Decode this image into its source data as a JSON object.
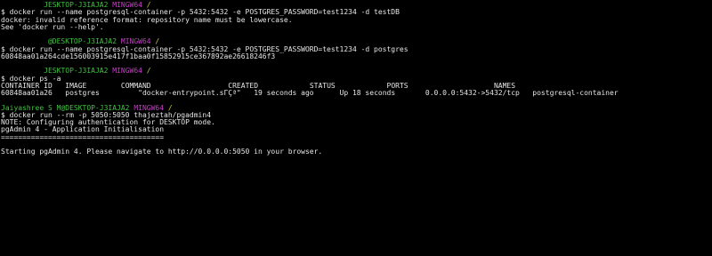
{
  "colors": {
    "background": "#000000",
    "text": "#e6e6e6",
    "user": "#3ec43e",
    "host": "#3ec43e",
    "shell": "#c23fc2",
    "path": "#c8c83a"
  },
  "lines": [
    {
      "type": "prompt",
      "user": "",
      "host": "JESKTOP-J3IAJA2",
      "shell": "MINGW64",
      "path": "/"
    },
    {
      "type": "text",
      "text": "$ docker run --name postgresql-container -p 5432:5432 -e POSTGRES_PASSWORD=test1234 -d testDB"
    },
    {
      "type": "text",
      "text": "docker: invalid reference format: repository name must be lowercase."
    },
    {
      "type": "text",
      "text": "See 'docker run --help'."
    },
    {
      "type": "blank"
    },
    {
      "type": "prompt",
      "user": "",
      "host": "@DESKTOP-J3IAJA2",
      "shell": "MINGW64",
      "path": "/"
    },
    {
      "type": "text",
      "text": "$ docker run --name postgresql-container -p 5432:5432 -e POSTGRES_PASSWORD=test1234 -d postgres"
    },
    {
      "type": "text",
      "text": "60848aa01a264cde156003915e417f1baa0f15852915ce367892ae26618246f3"
    },
    {
      "type": "blank"
    },
    {
      "type": "prompt",
      "user": "",
      "host": "JESKTOP-J3IAJA2",
      "shell": "MINGW64",
      "path": "/"
    },
    {
      "type": "text",
      "text": "$ docker ps -a"
    },
    {
      "type": "table",
      "columns": [
        "CONTAINER ID",
        "IMAGE",
        "COMMAND",
        "CREATED",
        "STATUS",
        "PORTS",
        "NAMES"
      ],
      "row": [
        "60848aa01a26",
        "postgres",
        "\"docker-entrypoint.sΓÇª\"",
        "19 seconds ago",
        "Up 18 seconds",
        "0.0.0.0:5432->5432/tcp",
        "postgresql-container"
      ]
    },
    {
      "type": "blank"
    },
    {
      "type": "prompt",
      "user": "Jaiyashree S M",
      "host": "@DESKTOP-J3IAJA2",
      "shell": "MINGW64",
      "path": "/"
    },
    {
      "type": "text",
      "text": "$ docker run --rm -p 5050:5050 thajeztah/pgadmin4"
    },
    {
      "type": "text",
      "text": "NOTE: Configuring authentication for DESKTOP mode."
    },
    {
      "type": "text",
      "text": "pgAdmin 4 - Application Initialisation"
    },
    {
      "type": "text",
      "text": "======================================"
    },
    {
      "type": "blank"
    },
    {
      "type": "text",
      "text": "Starting pgAdmin 4. Please navigate to http://0.0.0.0:5050 in your browser."
    }
  ]
}
